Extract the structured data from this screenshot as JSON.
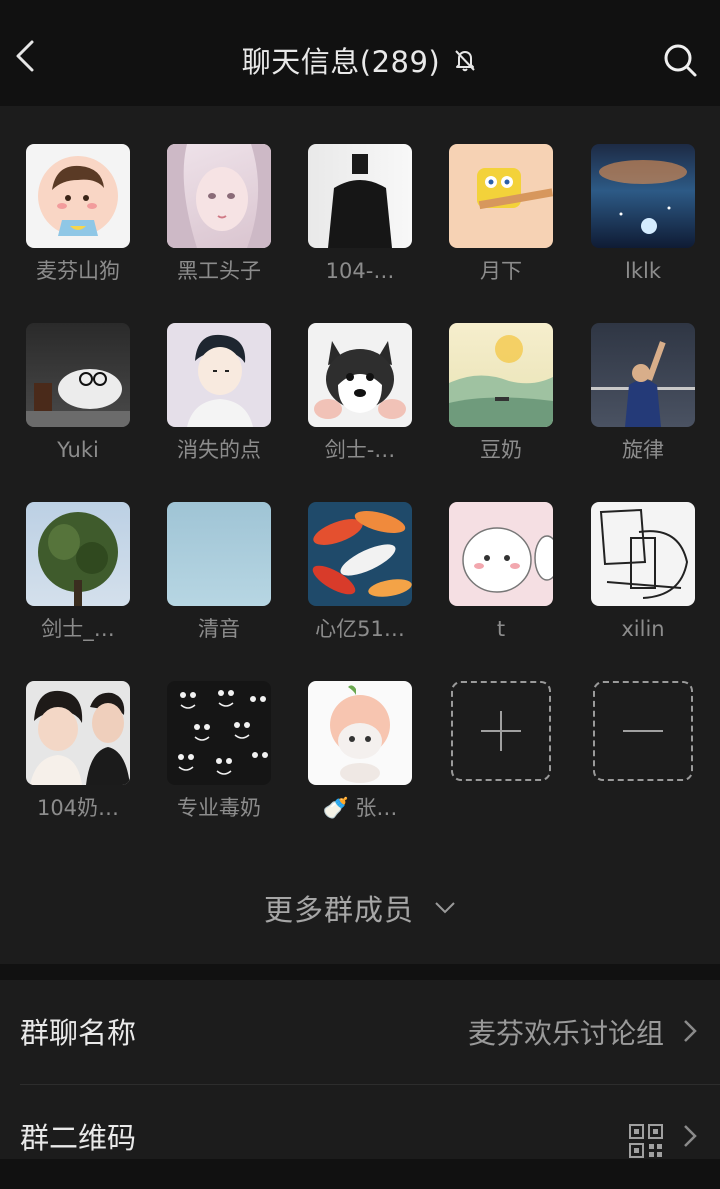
{
  "header": {
    "title": "聊天信息(289)"
  },
  "members": [
    {
      "name": "麦芬山狗",
      "avatar": "cartoon-boy-avatar"
    },
    {
      "name": "黑工头子",
      "avatar": "anime-girl-avatar"
    },
    {
      "name": "104-…",
      "avatar": "suit-figure-avatar"
    },
    {
      "name": "月下",
      "avatar": "spongebob-avatar"
    },
    {
      "name": "lklk",
      "avatar": "night-sky-avatar"
    },
    {
      "name": "Yuki",
      "avatar": "dog-glasses-avatar"
    },
    {
      "name": "消失的点",
      "avatar": "anime-boy-avatar"
    },
    {
      "name": "剑士-…",
      "avatar": "husky-avatar"
    },
    {
      "name": "豆奶",
      "avatar": "sunset-field-avatar"
    },
    {
      "name": "旋律",
      "avatar": "badminton-player-avatar"
    },
    {
      "name": "剑士_…",
      "avatar": "tree-avatar"
    },
    {
      "name": "清音",
      "avatar": "sky-blue-avatar"
    },
    {
      "name": "心亿51…",
      "avatar": "koi-fish-avatar"
    },
    {
      "name": "t",
      "avatar": "fluffy-cat-avatar"
    },
    {
      "name": "xilin",
      "avatar": "sketch-avatar"
    },
    {
      "name": "104奶…",
      "avatar": "couple-avatar"
    },
    {
      "name": "专业毒奶",
      "avatar": "black-cats-avatar"
    },
    {
      "name": "🍼 张…",
      "avatar": "peach-cat-avatar"
    }
  ],
  "more_members": {
    "label": "更多群成员"
  },
  "settings": {
    "group_name": {
      "label": "群聊名称",
      "value": "麦芬欢乐讨论组"
    },
    "qr_code": {
      "label": "群二维码"
    }
  },
  "colors": {
    "background": "#111111",
    "panel": "#1c1c1c",
    "text_primary": "#e9e9e9",
    "text_secondary": "#8c8c8c"
  }
}
